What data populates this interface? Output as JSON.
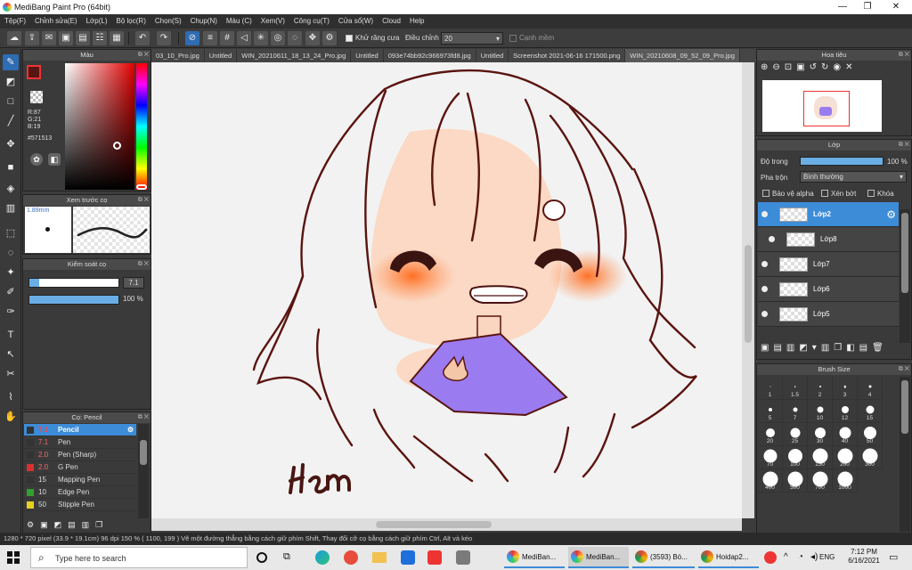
{
  "app": {
    "title": "MediBang Paint Pro (64bit)"
  },
  "menu": [
    "Tệp(F)",
    "Chỉnh sửa(E)",
    "Lớp(L)",
    "Bộ lọc(R)",
    "Chọn(S)",
    "Chụp(N)",
    "Màu (C)",
    "Xem(V)",
    "Công cụ(T)",
    "Cửa sổ(W)",
    "Cloud",
    "Help"
  ],
  "toolbar": {
    "antialias_label": "Khử răng cưa",
    "adjust_label": "Điều chỉnh",
    "adjust_value": "20",
    "smooth_label": "Cạnh mềm"
  },
  "tabs": [
    "03_10_Pro.jpg",
    "Untitled",
    "WIN_20210611_18_13_24_Pro.jpg",
    "Untitled",
    "093e74bb92c966973fd8.jpg",
    "Untitled",
    "Screenshot 2021-06-16 171500.png",
    "WIN_20210608_09_52_09_Pro.jpg"
  ],
  "color_panel": {
    "title": "Màu",
    "r": "R:87",
    "g": "G:21",
    "b": "B:19",
    "hex": "#571513",
    "fg": "#571513"
  },
  "brush_preview": {
    "title": "Xem trước cọ",
    "size": "1.89mm"
  },
  "brush_control": {
    "title": "Kiểm soát cọ",
    "size_value": "7.1",
    "opacity_value": "100 %"
  },
  "brush_list": {
    "title": "Cọ: Pencil",
    "items": [
      {
        "size": "7.1",
        "name": "Pencil",
        "color": "#333333"
      },
      {
        "size": "7.1",
        "name": "Pen",
        "color": "#333333"
      },
      {
        "size": "2.0",
        "name": "Pen (Sharp)",
        "color": "#333333"
      },
      {
        "size": "2.0",
        "name": "G Pen",
        "color": "#d83030"
      },
      {
        "size": "15",
        "name": "Mapping Pen",
        "color": "#333333"
      },
      {
        "size": "10",
        "name": "Edge Pen",
        "color": "#30a030"
      },
      {
        "size": "50",
        "name": "Stipple Pen",
        "color": "#e8d020"
      }
    ]
  },
  "navigator": {
    "title": "Hoa tiêu"
  },
  "layers_panel": {
    "title": "Lớp",
    "opacity_label": "Độ trong",
    "opacity_value": "100 %",
    "blend_label": "Pha trộn",
    "blend_value": "Bình thường",
    "protect_alpha": "Bảo vệ alpha",
    "clipping": "Xén bớt",
    "lock": "Khóa",
    "layers": [
      "Lớp2",
      "Lớp8",
      "Lớp7",
      "Lớp6",
      "Lớp5"
    ]
  },
  "brush_size": {
    "title": "Brush Size",
    "sizes": [
      "1",
      "1.5",
      "2",
      "3",
      "4",
      "5",
      "7",
      "10",
      "12",
      "15",
      "20",
      "25",
      "30",
      "40",
      "50",
      "70",
      "100",
      "150",
      "200",
      "300",
      "400",
      "500",
      "700",
      "1000"
    ]
  },
  "signature": "Hcm",
  "status": {
    "text": "1280 * 720 pixel   (33.9 * 19.1cm)   96 dpi   150 %   ( 1100, 199 )   Vẽ một đường thẳng bằng cách giữ phím Shift, Thay đổi cỡ cọ bằng cách giữ phím Ctrl, Alt và kéo"
  },
  "taskbar": {
    "search_placeholder": "Type here to search",
    "items": [
      "MediBan...",
      "MediBan...",
      "(3593) Bó...",
      "Hoidap2..."
    ],
    "lang": "ENG",
    "time": "7:12 PM",
    "date": "6/16/2021"
  }
}
